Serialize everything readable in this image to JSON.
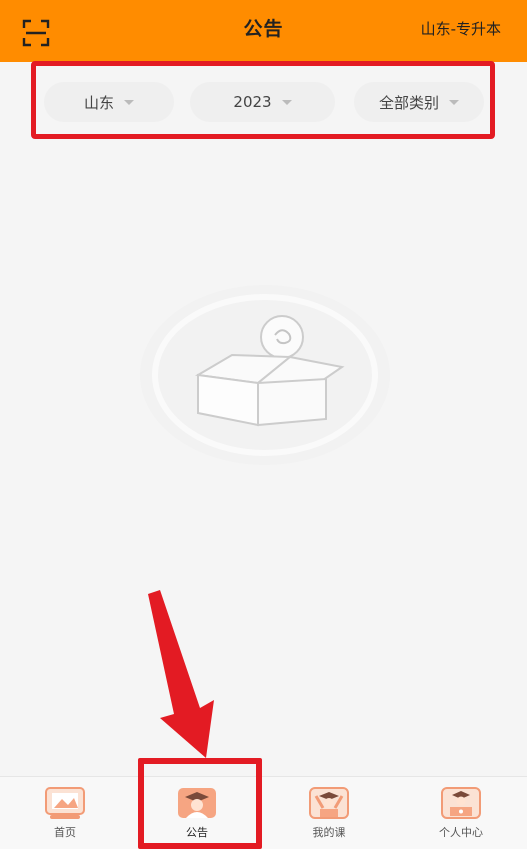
{
  "header": {
    "title": "公告",
    "region_label": "山东-专升本"
  },
  "filters": [
    {
      "label": "山东"
    },
    {
      "label": "2023"
    },
    {
      "label": "全部类别"
    }
  ],
  "tabs": [
    {
      "label": "首页"
    },
    {
      "label": "公告"
    },
    {
      "label": "我的课"
    },
    {
      "label": "个人中心"
    }
  ],
  "colors": {
    "header_bg": "#ff8c00",
    "highlight_red": "#e31b23",
    "background": "#f5f5f5"
  },
  "icons": {
    "header_left": "scan-icon",
    "empty_state": "empty-box-icon"
  }
}
